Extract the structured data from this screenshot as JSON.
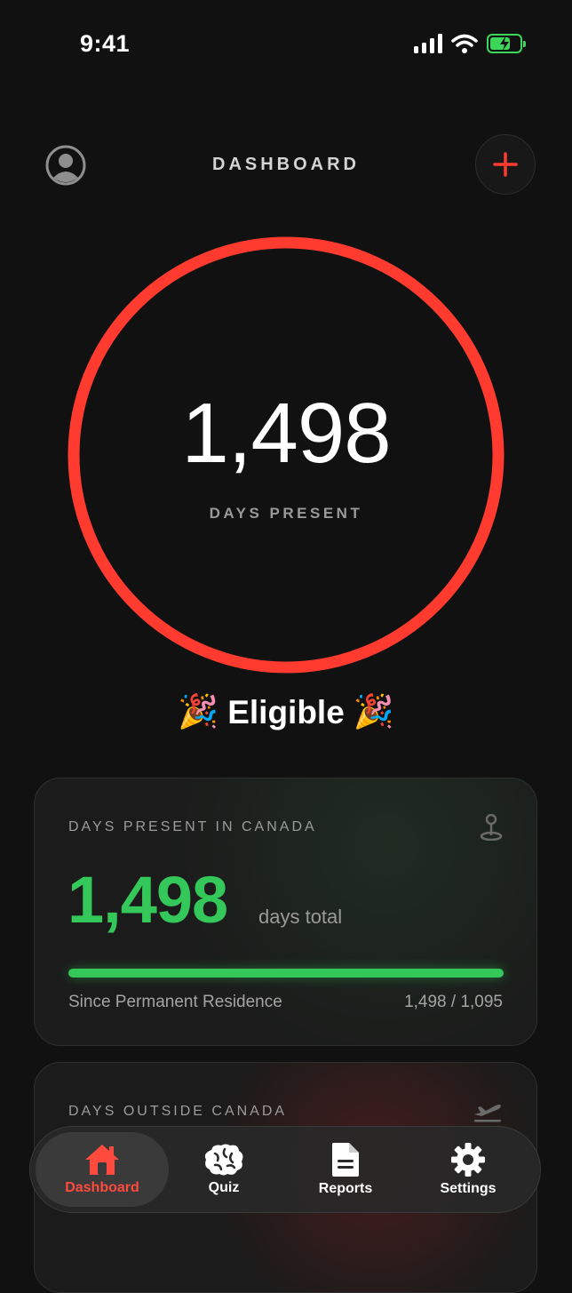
{
  "status": {
    "time": "9:41"
  },
  "header": {
    "title": "DASHBOARD"
  },
  "ring": {
    "count": "1,498",
    "label": "DAYS PRESENT",
    "color": "#ff3b30"
  },
  "eligibility": {
    "text": "Eligible",
    "emoji": "🎉"
  },
  "present_card": {
    "label": "DAYS PRESENT IN CANADA",
    "value": "1,498",
    "suffix": "days total",
    "progress": 1.0,
    "caption": "Since Permanent Residence",
    "ratio": "1,498 / 1,095",
    "accent": "#34c759",
    "icon": "location-pin-icon"
  },
  "outside_card": {
    "label": "DAYS OUTSIDE CANADA",
    "icon": "airplane-departure-icon"
  },
  "tabs": [
    {
      "label": "Dashboard",
      "icon": "home-icon",
      "active": true
    },
    {
      "label": "Quiz",
      "icon": "brain-icon",
      "active": false
    },
    {
      "label": "Reports",
      "icon": "document-icon",
      "active": false
    },
    {
      "label": "Settings",
      "icon": "gear-icon",
      "active": false
    }
  ]
}
